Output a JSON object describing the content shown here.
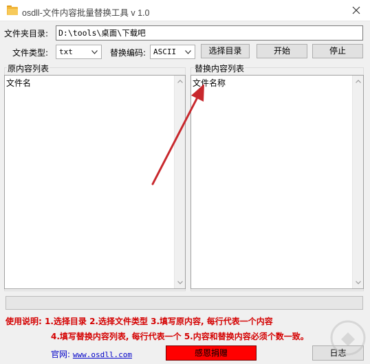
{
  "window": {
    "title": "osdll-文件内容批量替换工具 v 1.0",
    "app_icon": "folder-icon",
    "close_icon": "close-icon"
  },
  "folder_row": {
    "label": "文件夹目录:",
    "value": "D:\\tools\\桌面\\下载吧"
  },
  "options_row": {
    "file_type_label": "文件类型:",
    "file_type_value": "txt",
    "encoding_label": "替换编码:",
    "encoding_value": "ASCII",
    "select_dir_button": "选择目录",
    "start_button": "开始",
    "stop_button": "停止"
  },
  "original_panel": {
    "label": "原内容列表",
    "content": "文件名"
  },
  "replace_panel": {
    "label": "替换内容列表",
    "content": "文件名称"
  },
  "progress": {
    "value": 0
  },
  "usage": {
    "line1": "使用说明: 1.选择目录   2.选择文件类型   3.填写原内容, 每行代表一个内容",
    "line2": "4.填写替换内容列表, 每行代表一个   5.内容和替换内容必须个数一致。"
  },
  "footer": {
    "site_label": "官网:",
    "site_url": "www.osdll.com",
    "donate_button": "感恩捐赠",
    "log_button": "日志"
  },
  "colors": {
    "instruction_red": "#d40000",
    "donate_bg": "#ff0000",
    "link_blue": "#0000c8",
    "annotation_arrow": "#c8282d"
  }
}
